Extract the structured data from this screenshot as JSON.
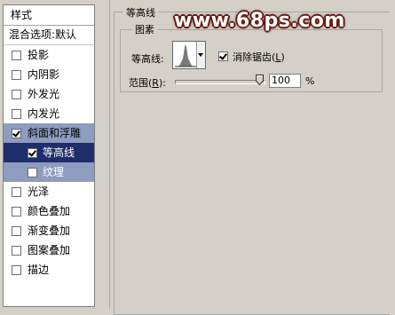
{
  "styles_panel": {
    "header": "样式",
    "blending_options": "混合选项:默认",
    "items": [
      {
        "label": "投影",
        "checked": false
      },
      {
        "label": "内阴影",
        "checked": false
      },
      {
        "label": "外发光",
        "checked": false
      },
      {
        "label": "内发光",
        "checked": false
      },
      {
        "label": "斜面和浮雕",
        "checked": true
      },
      {
        "label": "等高线",
        "checked": true
      },
      {
        "label": "纹理",
        "checked": false
      },
      {
        "label": "光泽",
        "checked": false
      },
      {
        "label": "颜色叠加",
        "checked": false
      },
      {
        "label": "渐变叠加",
        "checked": false
      },
      {
        "label": "图案叠加",
        "checked": false
      },
      {
        "label": "描边",
        "checked": false
      }
    ]
  },
  "contour_section": {
    "title": "等高线",
    "group_title": "图素",
    "contour_label": "等高线:",
    "antialias_label_main": "消除锯齿(",
    "antialias_label_key": "L",
    "antialias_label_end": ")",
    "antialias_checked": true,
    "range_label_main": "范围(",
    "range_label_key": "R",
    "range_label_end": "):",
    "range_value": "100",
    "range_unit": "%",
    "range_fraction": 1.0
  },
  "watermark": "www.68ps.com",
  "colors": {
    "selected_bg": "#1e2d6b",
    "parent_bg": "#8d9cbf",
    "panel_bg": "#d4d0c8",
    "watermark_outline": "#6b1a12"
  }
}
